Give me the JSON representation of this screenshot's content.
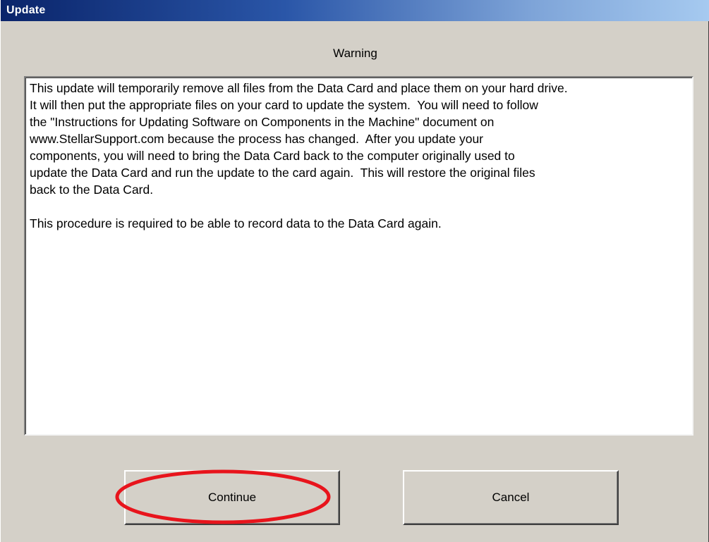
{
  "window": {
    "title": "Update"
  },
  "dialog": {
    "heading": "Warning",
    "message_paragraphs": [
      "This update will temporarily remove all files from the Data Card and place them on your hard drive.\nIt will then put the appropriate files on your card to update the system.  You will need to follow\nthe \"Instructions for Updating Software on Components in the Machine\" document on\nwww.StellarSupport.com because the process has changed.  After you update your\ncomponents, you will need to bring the Data Card back to the computer originally used to\nupdate the Data Card and run the update to the card again.  This will restore the original files\nback to the Data Card.",
      "This procedure is required to be able to record data to the Data Card again."
    ]
  },
  "buttons": {
    "continue_label": "Continue",
    "cancel_label": "Cancel"
  },
  "annotation": {
    "highlight_color": "#e8141c"
  },
  "colors": {
    "title_bar_start": "#0a246a",
    "title_bar_end": "#a6caf0",
    "face": "#d4d0c8"
  }
}
